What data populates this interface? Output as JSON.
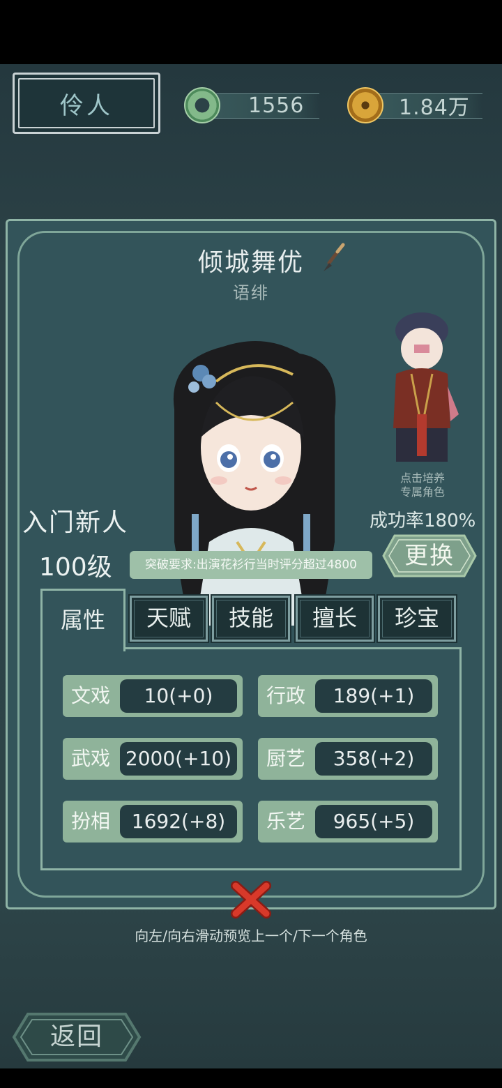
{
  "header": {
    "title": "伶人",
    "jade_value": "1556",
    "coin_value": "1.84万"
  },
  "character": {
    "title": "倾城舞优",
    "name": "语绯",
    "rank": "入门新人",
    "level": "100级",
    "breakthrough": "突破要求:出演花衫行当时评分超过4800",
    "success_rate": "成功率180%",
    "change_label": "更换",
    "cultivate_line1": "点击培养",
    "cultivate_line2": "专属角色"
  },
  "tabs": [
    "属性",
    "天赋",
    "技能",
    "擅长",
    "珍宝"
  ],
  "stats": [
    {
      "label": "文戏",
      "value": "10(+0)"
    },
    {
      "label": "行政",
      "value": "189(+1)"
    },
    {
      "label": "武戏",
      "value": "2000(+10)"
    },
    {
      "label": "厨艺",
      "value": "358(+2)"
    },
    {
      "label": "扮相",
      "value": "1692(+8)"
    },
    {
      "label": "乐艺",
      "value": "965(+5)"
    }
  ],
  "hint": "向左/向右滑动预览上一个/下一个角色",
  "back_label": "返回",
  "colors": {
    "background": "#2c4247",
    "panel": "#33545a",
    "stat_label_bg": "#8fb39a",
    "stat_value_bg": "#243c41",
    "close_red": "#d8392a"
  }
}
